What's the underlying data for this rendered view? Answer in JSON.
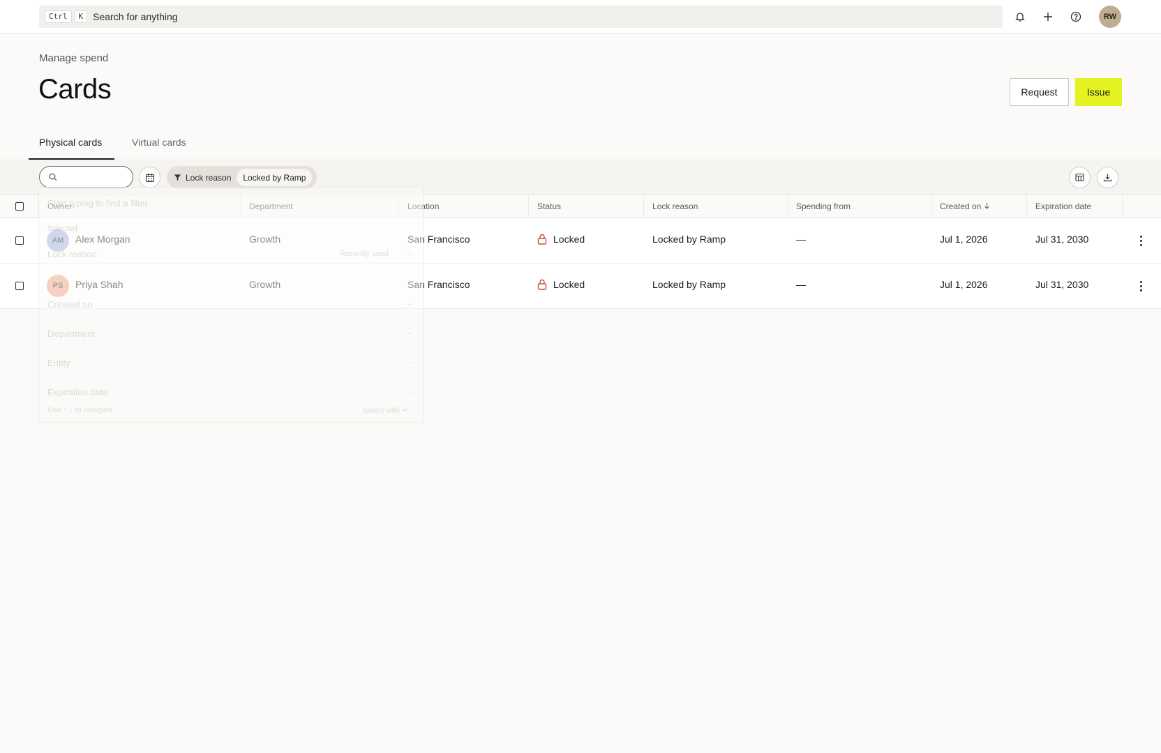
{
  "topbar": {
    "kbd_ctrl": "Ctrl",
    "kbd_k": "K",
    "search_placeholder": "Search for anything",
    "avatar_initials": "RW"
  },
  "header": {
    "breadcrumb": "Manage spend",
    "title": "Cards",
    "request_label": "Request",
    "issue_label": "Issue"
  },
  "tabs": [
    {
      "label": "Physical cards",
      "active": true
    },
    {
      "label": "Virtual cards",
      "active": false
    }
  ],
  "toolbar": {
    "search_value": "",
    "filter_label": "Lock reason",
    "filter_value": "Locked by Ramp"
  },
  "table": {
    "columns": [
      "Owner",
      "Department",
      "Location",
      "Status",
      "Lock reason",
      "Spending from",
      "Created on",
      "Expiration date"
    ],
    "rows": [
      {
        "initials": "AM",
        "owner": "Alex Morgan",
        "department": "Growth",
        "location": "San Francisco",
        "status": "Locked",
        "lock_reason": "Locked by Ramp",
        "spending_from": "—",
        "created_on": "Jul 1, 2026",
        "expiration": "Jul 31, 2030",
        "avatar_color": "#a8b6e0"
      },
      {
        "initials": "PS",
        "owner": "Priya Shah",
        "department": "Growth",
        "location": "San Francisco",
        "status": "Locked",
        "lock_reason": "Locked by Ramp",
        "spending_from": "—",
        "created_on": "Jul 1, 2026",
        "expiration": "Jul 31, 2030",
        "avatar_color": "#f1a789"
      }
    ]
  },
  "ghost_menu": {
    "hint": "Start typing to find a filter",
    "section": "Selected",
    "items": [
      "Lock reason",
      "Created on",
      "Department",
      "Entity",
      "Expiration date"
    ],
    "recent": "Recently used",
    "footer_left_prefix": "Use",
    "footer_left_suffix": "to navigate",
    "footer_right": "Select with"
  },
  "colors": {
    "accent": "#e4f222",
    "locked": "#c0522f"
  }
}
